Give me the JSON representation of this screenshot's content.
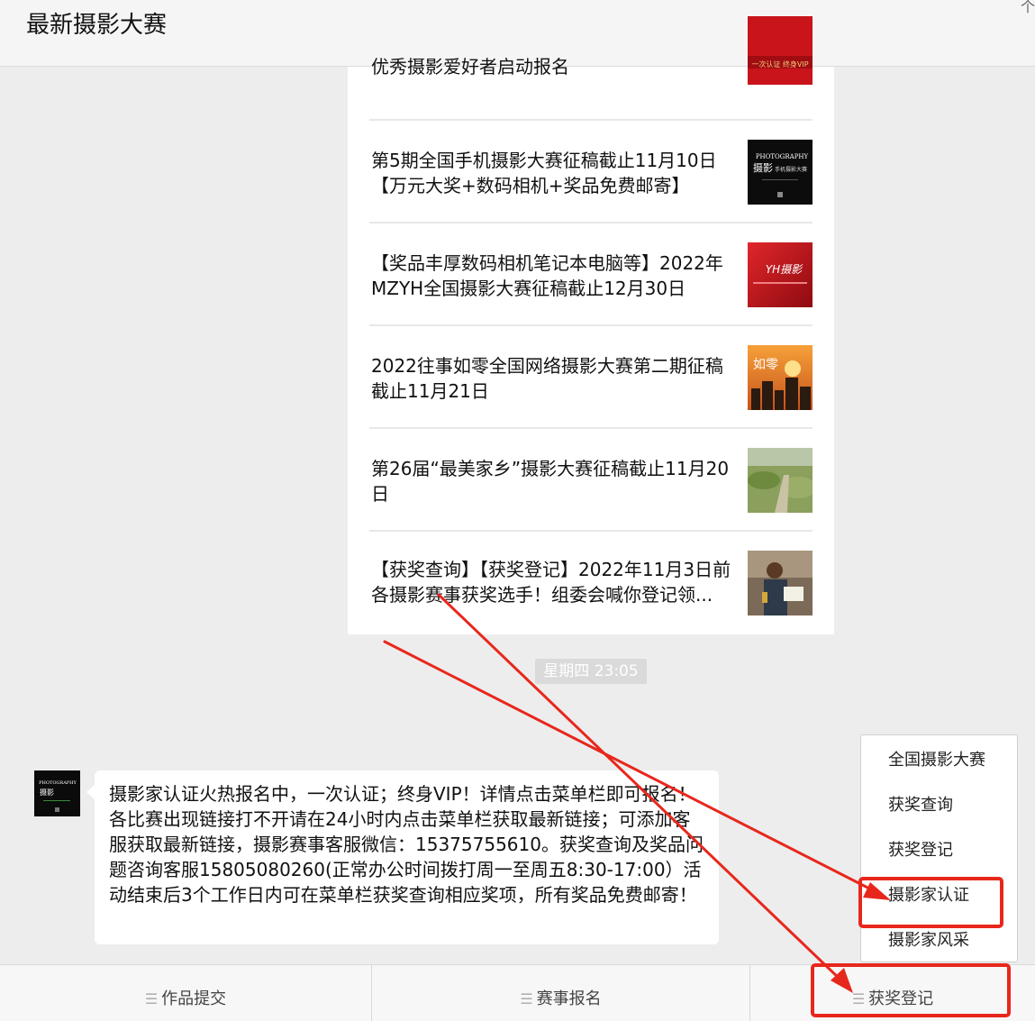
{
  "header": {
    "title": "最新摄影大赛",
    "corner_glyph": "个"
  },
  "articles": [
    {
      "title": "优秀摄影爱好者启动报名",
      "thumb": {
        "caption": "一次认证 终身VIP"
      }
    },
    {
      "title": "第5期全国手机摄影大赛征稿截止11月10日【万元大奖+数码相机+奖品免费邮寄】",
      "thumb": {
        "line1": "PHOTOGRAPHY",
        "line2": "摄影",
        "line3": "手机摄影大赛"
      }
    },
    {
      "title": "【奖品丰厚数码相机笔记本电脑等】2022年MZYH全国摄影大赛征稿截止12月30日",
      "thumb": {
        "caption": "YH摄影"
      }
    },
    {
      "title": "2022往事如零全国网络摄影大赛第二期征稿截止11月21日",
      "thumb": {
        "caption": "如零"
      }
    },
    {
      "title": "第26届“最美家乡”摄影大赛征稿截止11月20日",
      "thumb": {}
    },
    {
      "title": "【获奖查询】【获奖登记】2022年11月3日前各摄影赛事获奖选手！组委会喊你登记领...",
      "thumb": {}
    }
  ],
  "time_chip": "星期四  23:05",
  "message": {
    "avatar": {
      "line1": "PHOTOGRAPHY",
      "line2": "摄影"
    },
    "text": "摄影家认证火热报名中，一次认证；终身VIP！详情点击菜单栏即可报名！各比赛出现链接打不开请在24小时内点击菜单栏获取最新链接；可添加客服获取最新链接，摄影赛事客服微信：15375755610。获奖查询及奖品问题咨询客服15805080260(正常办公时间拨打周一至周五8:30-17:00）活动结束后3个工作日内可在菜单栏获奖查询相应奖项，所有奖品免费邮寄！"
  },
  "popup_menu": {
    "items": [
      "全国摄影大赛",
      "获奖查询",
      "获奖登记",
      "摄影家认证",
      "摄影家风采"
    ],
    "highlighted_index": 3
  },
  "menubar": {
    "glyph": "☰",
    "tabs": [
      "作品提交",
      "赛事报名",
      "获奖登记"
    ],
    "highlighted_index": 2
  },
  "colors": {
    "annotation_red": "#e8271c",
    "bubble_bg": "#ffffff",
    "chat_bg": "#ededed"
  }
}
